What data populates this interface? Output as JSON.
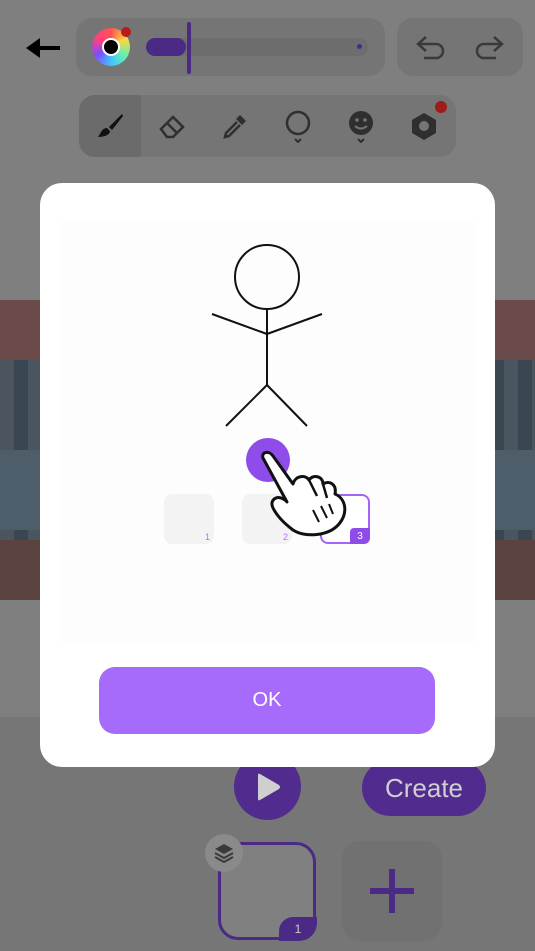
{
  "toolbar": {
    "brush_color": "#000000",
    "brush_size_fraction": 0.2,
    "tools": [
      "brush-icon",
      "eraser-icon",
      "eyedropper-icon",
      "lasso-icon",
      "sticker-icon",
      "shape-icon"
    ],
    "active_tool": "brush-icon"
  },
  "bottom": {
    "create_label": "Create",
    "current_frame_number": "1"
  },
  "dialog": {
    "frames": [
      {
        "number": "1"
      },
      {
        "number": "2"
      },
      {
        "number": "3"
      }
    ],
    "selected_frame": "3",
    "ok_label": "OK"
  },
  "colors": {
    "accent": "#a66bfa",
    "accent_dark": "#8e4de8"
  }
}
